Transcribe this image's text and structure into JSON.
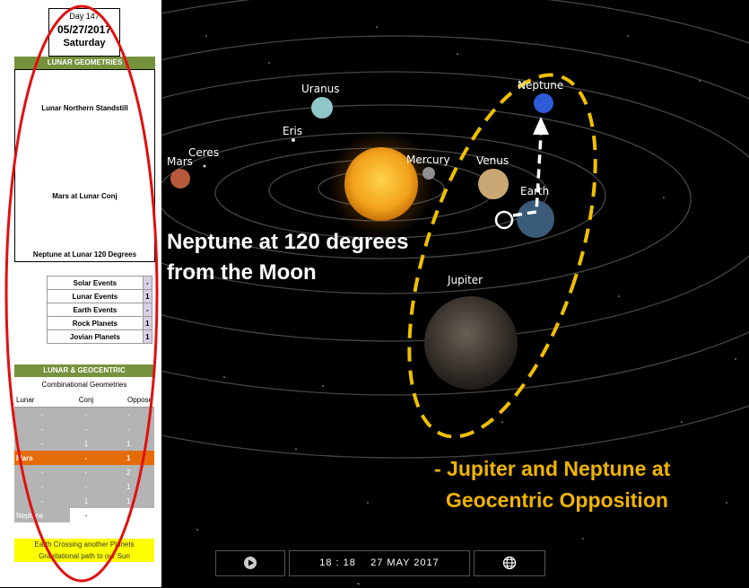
{
  "panel": {
    "day": "Day 147",
    "date": "05/27/2017",
    "weekday": "Saturday",
    "lunar_header": "LUNAR GEOMETRIES",
    "lunar_items": [
      "Lunar Northern Standstill",
      "Mars at Lunar Conj",
      "Neptune at Lunar 120 Degrees"
    ],
    "events": [
      {
        "name": "Solar Events",
        "value": "-"
      },
      {
        "name": "Lunar Events",
        "value": "1"
      },
      {
        "name": "Earth Events",
        "value": "-"
      },
      {
        "name": "Rock Planets",
        "value": "1"
      },
      {
        "name": "Jovian Planets",
        "value": "1"
      }
    ],
    "geo_header": "LUNAR & GEOCENTRIC",
    "combo_title": "Combinational Geometries",
    "combo_cols": [
      "Lunar",
      "Conj",
      "Oppose"
    ],
    "combo_rows": [
      [
        "-",
        "-",
        "-"
      ],
      [
        "-",
        "-",
        "-"
      ],
      [
        "-",
        "1",
        "1"
      ],
      [
        "Mars",
        "-",
        "1"
      ],
      [
        "-",
        "-",
        "2"
      ],
      [
        "-",
        "-",
        "1"
      ],
      [
        "-",
        "1",
        "1"
      ],
      [
        "Neptune",
        "-",
        "-"
      ]
    ],
    "note_line1": "Earth Crossing another Planets",
    "note_line2": "Gravitational path to our Sun"
  },
  "scene": {
    "planets": {
      "uranus": "Uranus",
      "neptune": "Neptune",
      "eris": "Eris",
      "ceres": "Ceres",
      "mars": "Mars",
      "mercury": "Mercury",
      "venus": "Venus",
      "earth": "Earth",
      "jupiter": "Jupiter"
    },
    "annotation_white_1": "Neptune at 120 degrees",
    "annotation_white_2": "from the Moon",
    "annotation_gold_1": "- Jupiter and Neptune at",
    "annotation_gold_2": "Geocentric Opposition",
    "colors": {
      "accent": "#f0b400",
      "sun": "#f5a623",
      "panel_green": "#76923c",
      "highlight": "#e36c09"
    }
  },
  "controls": {
    "time": "18 : 18",
    "date": "27 MAY 2017",
    "play_icon": "play-icon",
    "globe_icon": "globe-icon"
  }
}
